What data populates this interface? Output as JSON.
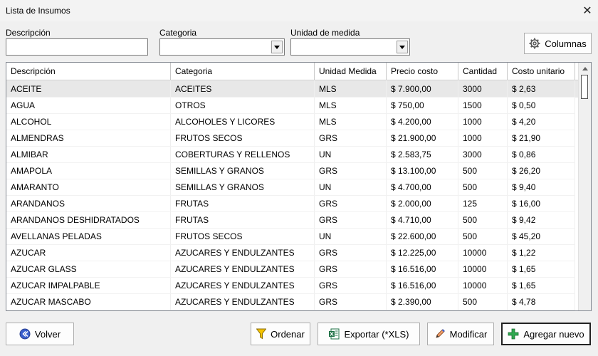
{
  "window": {
    "title": "Lista de Insumos",
    "close_glyph": "✕"
  },
  "filters": {
    "descripcion_label": "Descripción",
    "descripcion_value": "",
    "categoria_label": "Categoria",
    "categoria_value": "",
    "unidad_label": "Unidad de medida",
    "unidad_value": ""
  },
  "columns_button": {
    "label": "Columnas",
    "icon": "gear-icon"
  },
  "table": {
    "headers": [
      "Descripción",
      "Categoria",
      "Unidad Medida",
      "Precio costo",
      "Cantidad",
      "Costo unitario"
    ],
    "rows": [
      [
        "ACEITE",
        "ACEITES",
        "MLS",
        "$ 7.900,00",
        "3000",
        "$ 2,63"
      ],
      [
        "AGUA",
        "OTROS",
        "MLS",
        "$ 750,00",
        "1500",
        "$ 0,50"
      ],
      [
        "ALCOHOL",
        "ALCOHOLES Y LICORES",
        "MLS",
        "$ 4.200,00",
        "1000",
        "$ 4,20"
      ],
      [
        "ALMENDRAS",
        "FRUTOS SECOS",
        "GRS",
        "$ 21.900,00",
        "1000",
        "$ 21,90"
      ],
      [
        "ALMIBAR",
        "COBERTURAS Y RELLENOS",
        "UN",
        "$ 2.583,75",
        "3000",
        "$ 0,86"
      ],
      [
        "AMAPOLA",
        "SEMILLAS Y GRANOS",
        "GRS",
        "$ 13.100,00",
        "500",
        "$ 26,20"
      ],
      [
        "AMARANTO",
        "SEMILLAS Y GRANOS",
        "UN",
        "$ 4.700,00",
        "500",
        "$ 9,40"
      ],
      [
        "ARANDANOS",
        "FRUTAS",
        "GRS",
        "$ 2.000,00",
        "125",
        "$ 16,00"
      ],
      [
        "ARANDANOS DESHIDRATADOS",
        "FRUTAS",
        "GRS",
        "$ 4.710,00",
        "500",
        "$ 9,42"
      ],
      [
        "AVELLANAS PELADAS",
        "FRUTOS SECOS",
        "UN",
        "$ 22.600,00",
        "500",
        "$ 45,20"
      ],
      [
        "AZUCAR",
        "AZUCARES Y ENDULZANTES",
        "GRS",
        "$ 12.225,00",
        "10000",
        "$ 1,22"
      ],
      [
        "AZUCAR GLASS",
        "AZUCARES Y ENDULZANTES",
        "GRS",
        "$ 16.516,00",
        "10000",
        "$ 1,65"
      ],
      [
        "AZUCAR IMPALPABLE",
        "AZUCARES Y ENDULZANTES",
        "GRS",
        "$ 16.516,00",
        "10000",
        "$ 1,65"
      ],
      [
        "AZUCAR MASCABO",
        "AZUCARES Y ENDULZANTES",
        "GRS",
        "$ 2.390,00",
        "500",
        "$ 4,78"
      ]
    ],
    "selected_row": 0
  },
  "footer": {
    "volver": "Volver",
    "ordenar": "Ordenar",
    "exportar": "Exportar (*XLS)",
    "modificar": "Modificar",
    "agregar": "Agregar nuevo"
  },
  "colors": {
    "accent_blue": "#3a5fcd",
    "filter_yellow": "#f5c400",
    "add_green": "#2fa84f",
    "excel_green": "#1d7044"
  }
}
